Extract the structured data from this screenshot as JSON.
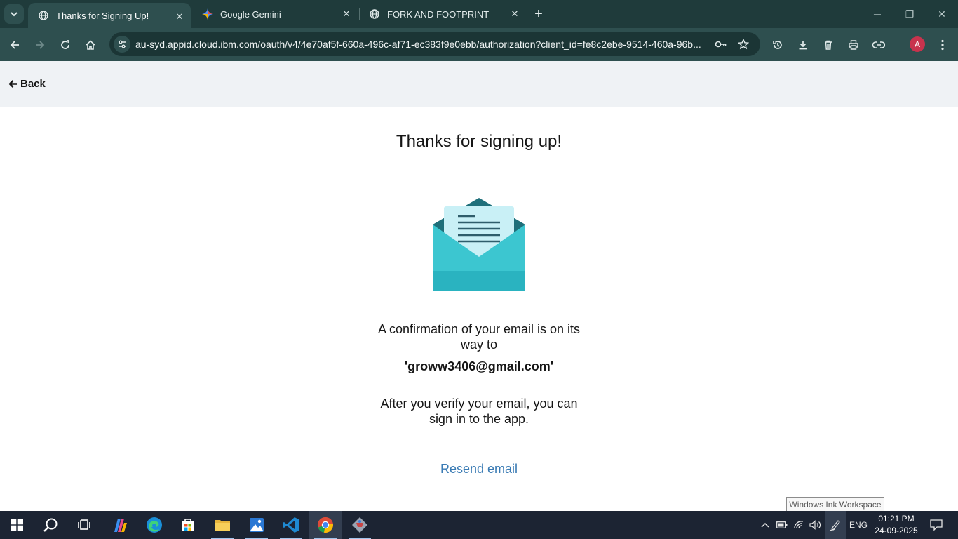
{
  "browser": {
    "tabs": [
      {
        "title": "Thanks for Signing Up!",
        "active": true,
        "favicon": "globe-icon"
      },
      {
        "title": "Google Gemini",
        "active": false,
        "favicon": "gemini-star-icon"
      },
      {
        "title": "FORK AND FOOTPRINT",
        "active": false,
        "favicon": "globe-icon"
      }
    ],
    "url": "au-syd.appid.cloud.ibm.com/oauth/v4/4e70af5f-660a-496c-af71-ec383f9e0ebb/authorization?client_id=fe8c2ebe-9514-460a-96b...",
    "profile_initial": "A",
    "colors": {
      "frame": "#1f3b3b",
      "toolbar": "#2e4f4f",
      "omnibox": "#1b3535",
      "avatar": "#c8334d"
    }
  },
  "page": {
    "back_label": "Back",
    "title": "Thanks for signing up!",
    "confirmation_text": "A confirmation of your email is on its way to",
    "email": "'groww3406@gmail.com'",
    "verify_text": "After you verify your email, you can sign in to the app.",
    "resend_label": "Resend email",
    "colors": {
      "header_bg": "#eff2f5",
      "link": "#3a7bb4",
      "envelope": "#3cc6d0",
      "letter": "#c9f0f6"
    }
  },
  "tooltip": "Windows Ink Workspace",
  "taskbar": {
    "apps": [
      "start-icon",
      "search-icon",
      "task-view-icon",
      "copilot-icon",
      "edge-icon",
      "store-icon",
      "file-explorer-icon",
      "photos-icon",
      "vscode-icon",
      "chrome-icon",
      "git-icon"
    ],
    "language": "ENG",
    "time": "01:21 PM",
    "date": "24-09-2025"
  }
}
